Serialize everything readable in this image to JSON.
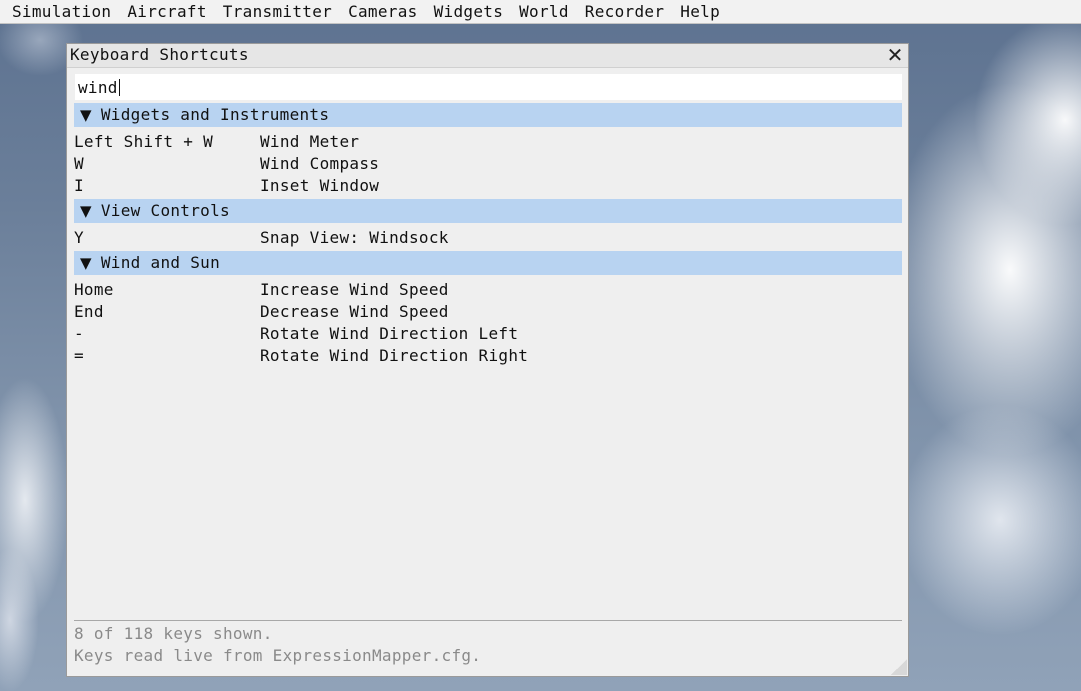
{
  "menubar": {
    "items": [
      "Simulation",
      "Aircraft",
      "Transmitter",
      "Cameras",
      "Widgets",
      "World",
      "Recorder",
      "Help"
    ]
  },
  "dialog": {
    "title": "Keyboard Shortcuts",
    "close_icon": "close-icon",
    "close_glyph": "✕",
    "search": {
      "value": "wind"
    },
    "expanded_icon": "triangle-down-icon",
    "expanded_glyph": "▼",
    "sections": [
      {
        "title": "Widgets and Instruments",
        "rows": [
          {
            "key": "Left Shift + W",
            "action": "Wind Meter"
          },
          {
            "key": "W",
            "action": "Wind Compass"
          },
          {
            "key": "I",
            "action": "Inset Window"
          }
        ]
      },
      {
        "title": "View Controls",
        "rows": [
          {
            "key": "Y",
            "action": "Snap View: Windsock"
          }
        ]
      },
      {
        "title": "Wind and Sun",
        "rows": [
          {
            "key": "Home",
            "action": "Increase Wind Speed"
          },
          {
            "key": "End",
            "action": "Decrease Wind Speed"
          },
          {
            "key": "-",
            "action": "Rotate Wind Direction Left"
          },
          {
            "key": "=",
            "action": "Rotate Wind Direction Right"
          }
        ]
      }
    ],
    "footer": {
      "count_text": "8 of 118 keys shown.",
      "source_text": "Keys read live from ExpressionMapper.cfg."
    }
  },
  "colors": {
    "section_header_bg": "#b8d3f1",
    "dialog_bg": "#efefef",
    "menubar_bg": "#f2f2f2",
    "footer_text": "#8a8a8a"
  }
}
